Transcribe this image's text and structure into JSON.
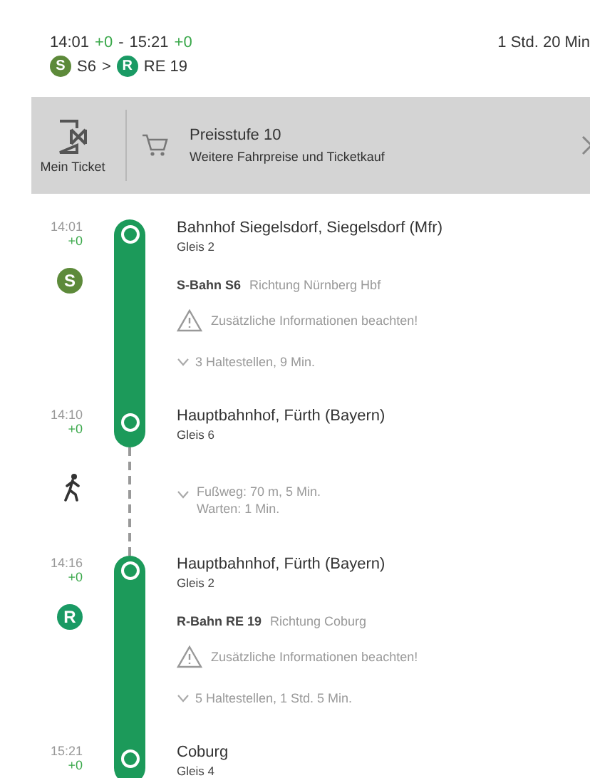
{
  "header": {
    "departure": "14:01",
    "departure_delay": "+0",
    "separator": "-",
    "arrival": "15:21",
    "arrival_delay": "+0",
    "duration": "1 Std. 20 Min",
    "route": [
      {
        "color": "#5d8a3a",
        "badge": "S",
        "line": "S6"
      },
      {
        "color": "#1a9a64",
        "badge": "R",
        "line": "RE 19"
      }
    ],
    "route_separator": ">"
  },
  "ticket_bar": {
    "my_ticket": "Mein Ticket",
    "price_level": "Preisstufe 10",
    "subtitle": "Weitere Fahrpreise und Ticketkauf"
  },
  "journey": [
    {
      "kind": "stop",
      "time": "14:01",
      "delay": "+0",
      "name": "Bahnhof Siegelsdorf, Siegelsdorf (Mfr)",
      "platform": "Gleis 2"
    },
    {
      "kind": "train",
      "color": "#5d8a3a",
      "badge": "S",
      "line": "S-Bahn S6",
      "direction": "Richtung Nürnberg Hbf",
      "notice": "Zusätzliche Informationen beachten!",
      "stops": "3 Haltestellen, 9 Min."
    },
    {
      "kind": "stop",
      "time": "14:10",
      "delay": "+0",
      "name": "Hauptbahnhof, Fürth (Bayern)",
      "platform": "Gleis 6"
    },
    {
      "kind": "walk",
      "lines": [
        "Fußweg: 70 m, 5 Min.",
        "Warten: 1 Min."
      ]
    },
    {
      "kind": "stop",
      "time": "14:16",
      "delay": "+0",
      "name": "Hauptbahnhof, Fürth (Bayern)",
      "platform": "Gleis 2"
    },
    {
      "kind": "train",
      "color": "#1a9a64",
      "badge": "R",
      "line": "R-Bahn RE 19",
      "direction": "Richtung Coburg",
      "notice": "Zusätzliche Informationen beachten!",
      "stops": "5 Haltestellen, 1 Std. 5 Min."
    },
    {
      "kind": "stop",
      "time": "15:21",
      "delay": "+0",
      "name": "Coburg",
      "platform": "Gleis 4"
    }
  ]
}
